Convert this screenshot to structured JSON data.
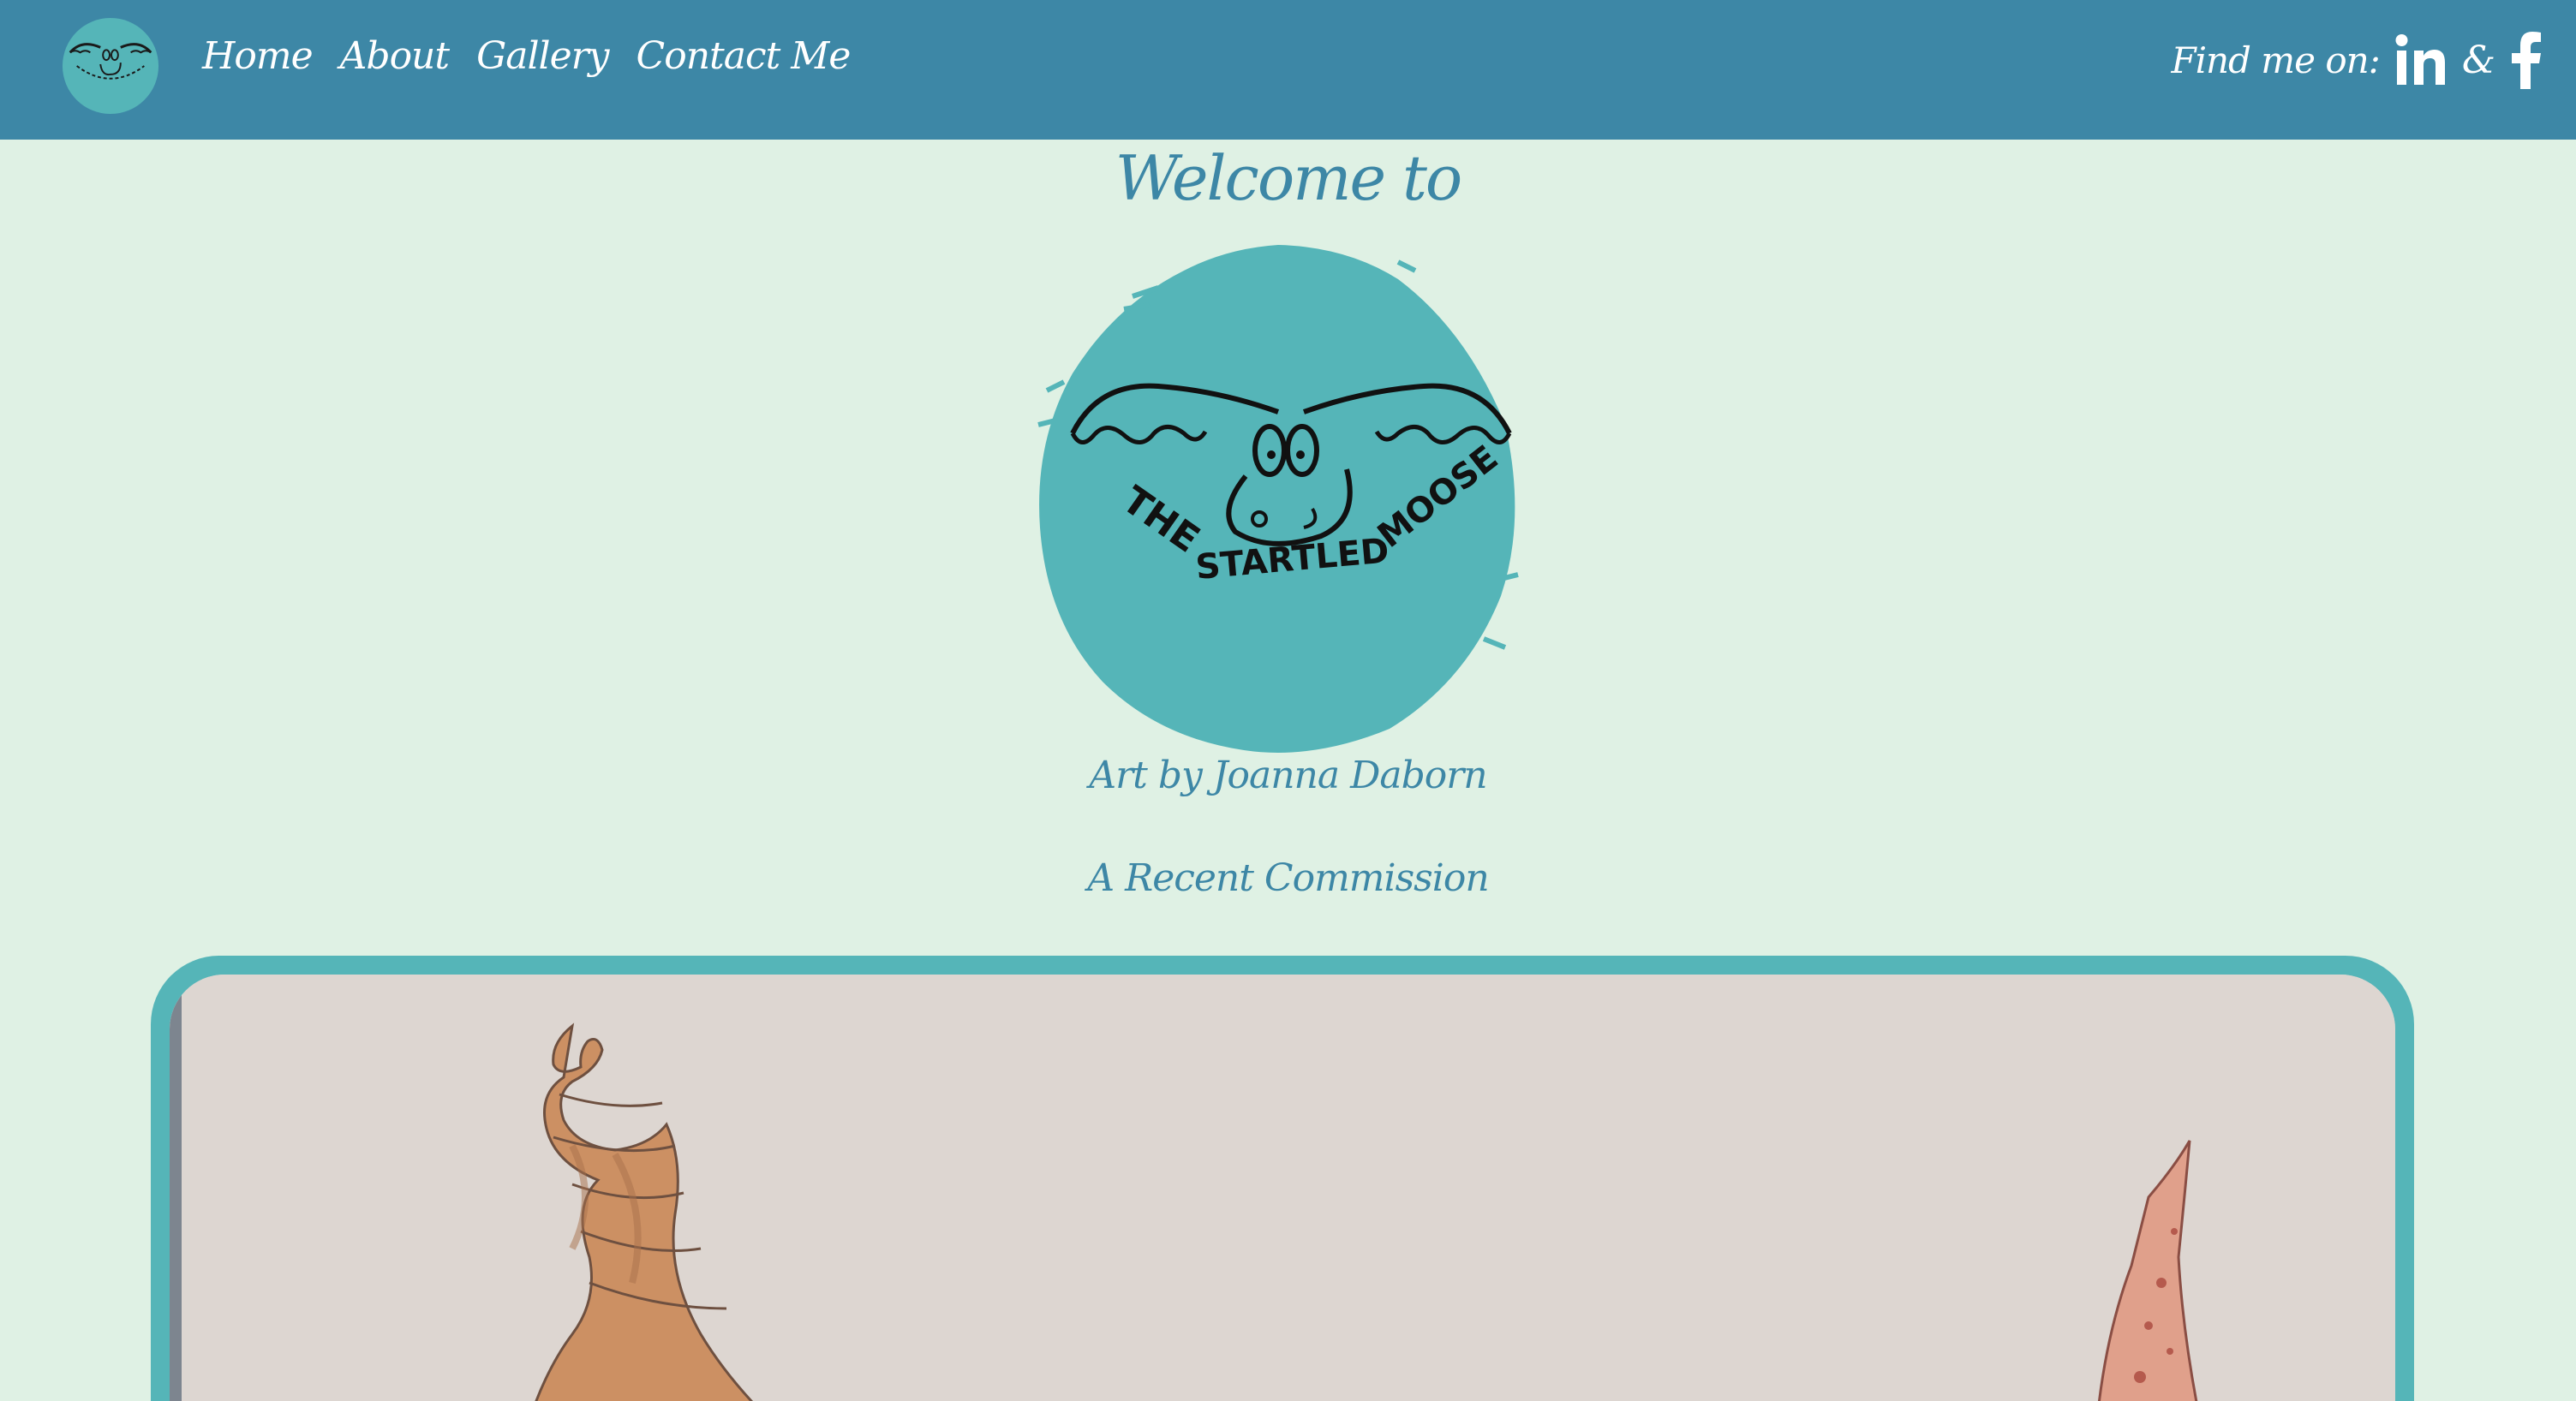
{
  "nav": {
    "items": [
      {
        "label": "Home"
      },
      {
        "label": "About"
      },
      {
        "label": "Gallery"
      },
      {
        "label": "Contact Me"
      }
    ],
    "find_me_label": "Find me on:",
    "separator": "&",
    "social": [
      {
        "icon": "linkedin-icon"
      },
      {
        "icon": "facebook-icon"
      }
    ],
    "logo_icon": "startled-moose-logo"
  },
  "hero": {
    "welcome": "Welcome to",
    "logo_text": "THE STARTLED MOOSE",
    "subtitle": "Art by Joanna Daborn"
  },
  "commission": {
    "title": "A Recent Commission",
    "image_icon": "seashell-painting"
  },
  "colors": {
    "navbar": "#3d87a6",
    "background": "#dff1e4",
    "accent": "#55b5b8",
    "text": "#3d87a6"
  }
}
